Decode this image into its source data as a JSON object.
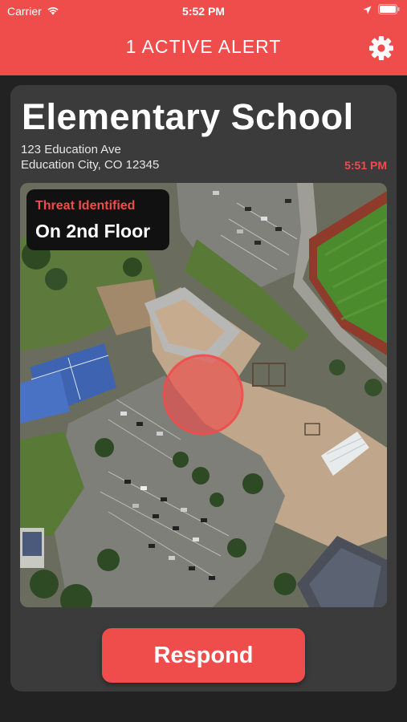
{
  "status_bar": {
    "carrier": "Carrier",
    "time": "5:52 PM",
    "icons": [
      "wifi-icon",
      "location-arrow-icon",
      "battery-icon"
    ]
  },
  "nav": {
    "title": "1 ACTIVE ALERT",
    "settings_icon": "gear-icon"
  },
  "alert": {
    "school_name": "Elementary School",
    "address_line1": "123 Education Ave",
    "address_line2": "Education City, CO 12345",
    "time": "5:51 PM",
    "threat_label": "Threat Identified",
    "threat_location": "On 2nd Floor"
  },
  "map": {
    "type": "satellite",
    "marker": "threat-location-marker"
  },
  "actions": {
    "respond_label": "Respond"
  },
  "colors": {
    "accent": "#ef4d4b",
    "background": "#222222",
    "card": "#3b3b3b",
    "callout": "#111111"
  }
}
